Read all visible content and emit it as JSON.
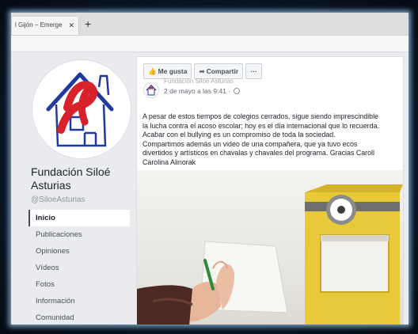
{
  "browser": {
    "tab_title": "l Gijón – Emerge",
    "tab_close_icon": "close-icon",
    "new_tab_glyph": "+"
  },
  "page": {
    "name": "Fundación Siloé Asturias",
    "handle": "@SiloeAsturias",
    "nav": [
      {
        "label": "Inicio",
        "active": true
      },
      {
        "label": "Publicaciones"
      },
      {
        "label": "Opiniones"
      },
      {
        "label": "Vídeos"
      },
      {
        "label": "Fotos"
      },
      {
        "label": "Información"
      },
      {
        "label": "Comunidad"
      }
    ]
  },
  "post": {
    "actions": {
      "like": "Me gusta",
      "share": "Compartir",
      "more": "···"
    },
    "author": "Fundación Siloé Asturias",
    "timestamp": "2 de mayo a las 9:41 ·",
    "text_lines": [
      "A pesar de estos tiempos de colegios cerrados, sigue siendo imprescindible",
      "la lucha contra el acoso escolar; hoy es el día internacional que lo recuerda.",
      "Acabar con el bullying es un compromiso de toda la sociedad.",
      "Compartimos además un video de una compañera, que ya tuvo ecos",
      "divertidos y artísticos en chavalas y chavales del programa. Gracias Caroll",
      "Carolina Alinorak"
    ]
  },
  "colors": {
    "fb_background": "#e9ebee",
    "logo_red": "#d8222b",
    "logo_blue": "#1f3a9c",
    "minion_yellow": "#e8c93a"
  }
}
